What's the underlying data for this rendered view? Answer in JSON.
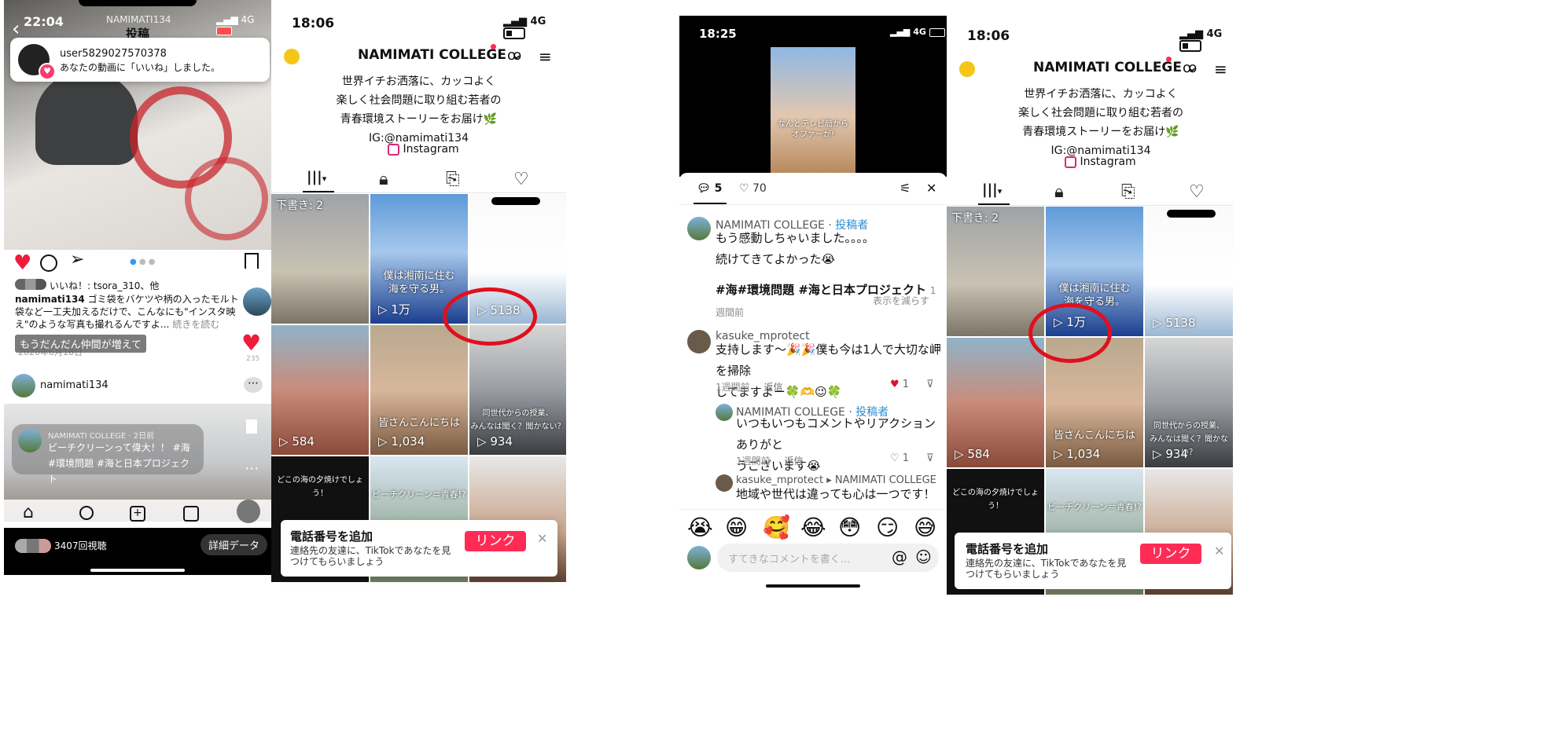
{
  "instagram": {
    "status_time": "22:04",
    "account": "NAMIMATI134",
    "page_title": "投稿",
    "notification": {
      "user": "user5829027570378",
      "text": "あなたの動画に「いいね」しました。"
    },
    "likes_line": "いいね！: tsora_310、他",
    "caption_user": "namimati134",
    "caption_text": "ゴミ袋をバケツや柄の入ったモルト袋など一工夫加えるだけで、こんなにも\"インスタ映え\"のような写真も撮れるんですよ...",
    "read_more": "続きを読む",
    "overlay_text": "もうだんだん仲間が増えて",
    "date_text": "2020年6月18日",
    "like_count": "235",
    "profile_name": "namimati134",
    "msg_name": "NAMIMATI COLLEGE · 2日前",
    "msg_text": "ビーチクリーンって偉大！！ #海#環境問題 #海と日本プロジェクト",
    "views": "3407回視聴",
    "details_button": "詳細データ"
  },
  "tiktok_a": {
    "status_time": "18:06",
    "network": "4G",
    "account_name": "NAMIMATI COLLEGE",
    "bio": [
      "世界イチお洒落に、カッコよく",
      "楽しく社会問題に取り組む若者の",
      "青春環境ストーリーをお届け🌿",
      "IG:@namimati134"
    ],
    "instagram_label": "Instagram",
    "drafts": "下書き: 2",
    "grid": [
      {
        "views": "",
        "caption": ""
      },
      {
        "views": "1万",
        "caption": "僕は湘南に住む\n海を守る男。"
      },
      {
        "views": "5138",
        "caption": ""
      },
      {
        "views": "584",
        "caption": ""
      },
      {
        "views": "1,034",
        "caption": "皆さんこんにちは"
      },
      {
        "views": "934",
        "caption": "同世代からの授業、\nみんなは聞く？聞かない？"
      },
      {
        "views": "",
        "caption": "どこの海の夕焼けでしょう！"
      },
      {
        "views": "",
        "caption": "ビーチクリーン＝青春!?"
      },
      {
        "views": "",
        "caption": ""
      }
    ],
    "banner_title": "電話番号を追加",
    "banner_text": "連絡先の友達に、TikTokであなたを見つけてもらいましょう",
    "banner_button": "リンク"
  },
  "tiktok_comments": {
    "status_time": "18:25",
    "network": "4G",
    "video_caption": "なんとテレビ局から\nオファーが!",
    "comment_count": "5",
    "like_count": "70",
    "comments": [
      {
        "user": "NAMIMATI COLLEGE",
        "badge": "投稿者",
        "lines": [
          "もう感動しちゃいました。。。。",
          "続けてきてよかった😭",
          "",
          "#海#環境問題 #海と日本プロジェクト"
        ],
        "time": "1週間前",
        "extra": "表示を減らす"
      },
      {
        "user": "kasuke_mprotect",
        "lines": [
          "支持します〜🎉🎉僕も今は1人で大切な岬を掃除",
          "してますよー🍀🫶😉🍀"
        ],
        "time": "1週間前",
        "reply": "返信",
        "likes": "1"
      },
      {
        "user": "NAMIMATI COLLEGE",
        "badge": "投稿者",
        "lines": [
          "いつもいつもコメントやリアクションありがと",
          "うございます😭"
        ],
        "time": "1週間前",
        "reply": "返信",
        "likes": "1"
      },
      {
        "user": "kasuke_mprotect ▸ NAMIMATI COLLEGE",
        "lines": [
          "地域や世代は違っても心は一つです！いつも学"
        ]
      }
    ],
    "emojis": [
      "😭",
      "😁",
      "🥰",
      "😂",
      "😳",
      "😏",
      "😅"
    ],
    "input_placeholder": "すてきなコメントを書く..."
  },
  "tiktok_b": {
    "status_time": "18:06",
    "network": "4G",
    "account_name": "NAMIMATI COLLEGE",
    "bio": [
      "世界イチお洒落に、カッコよく",
      "楽しく社会問題に取り組む若者の",
      "青春環境ストーリーをお届け🌿",
      "IG:@namimati134"
    ],
    "instagram_label": "Instagram",
    "drafts": "下書き: 2",
    "grid": [
      {
        "views": "",
        "caption": ""
      },
      {
        "views": "1万",
        "caption": "僕は湘南に住む\n海を守る男。"
      },
      {
        "views": "5138",
        "caption": ""
      },
      {
        "views": "584",
        "caption": ""
      },
      {
        "views": "1,034",
        "caption": "皆さんこんにちは"
      },
      {
        "views": "934",
        "caption": "同世代からの授業、\nみんなは聞く？聞かない？"
      },
      {
        "views": "",
        "caption": "どこの海の夕焼けでしょう！"
      },
      {
        "views": "",
        "caption": "ビーチクリーン＝青春!?"
      },
      {
        "views": "",
        "caption": ""
      }
    ],
    "banner_title": "電話番号を追加",
    "banner_text": "連絡先の友達に、TikTokであなたを見つけてもらいましょう",
    "banner_button": "リンク"
  }
}
